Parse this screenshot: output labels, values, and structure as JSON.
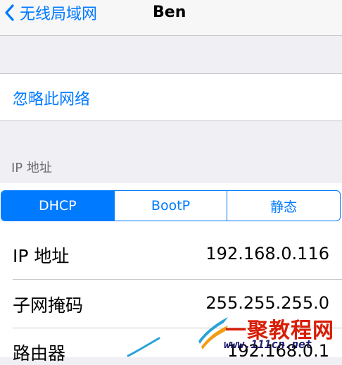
{
  "nav": {
    "back_label": "无线局域网",
    "title": "Ben"
  },
  "forget_label": "忽略此网络",
  "ip_section_header": "IP 地址",
  "segments": [
    "DHCP",
    "BootP",
    "静态"
  ],
  "fields": [
    {
      "label": "IP 地址",
      "value": "192.168.0.116"
    },
    {
      "label": "子网掩码",
      "value": "255.255.255.0"
    },
    {
      "label": "路由器",
      "value": "192.168.0.1"
    }
  ],
  "watermark": {
    "text": "一聚教程网",
    "url": "www.111cn.net"
  },
  "colors": {
    "accent": "#007aff",
    "background": "#efeff4",
    "separator": "#c8c7cc"
  }
}
